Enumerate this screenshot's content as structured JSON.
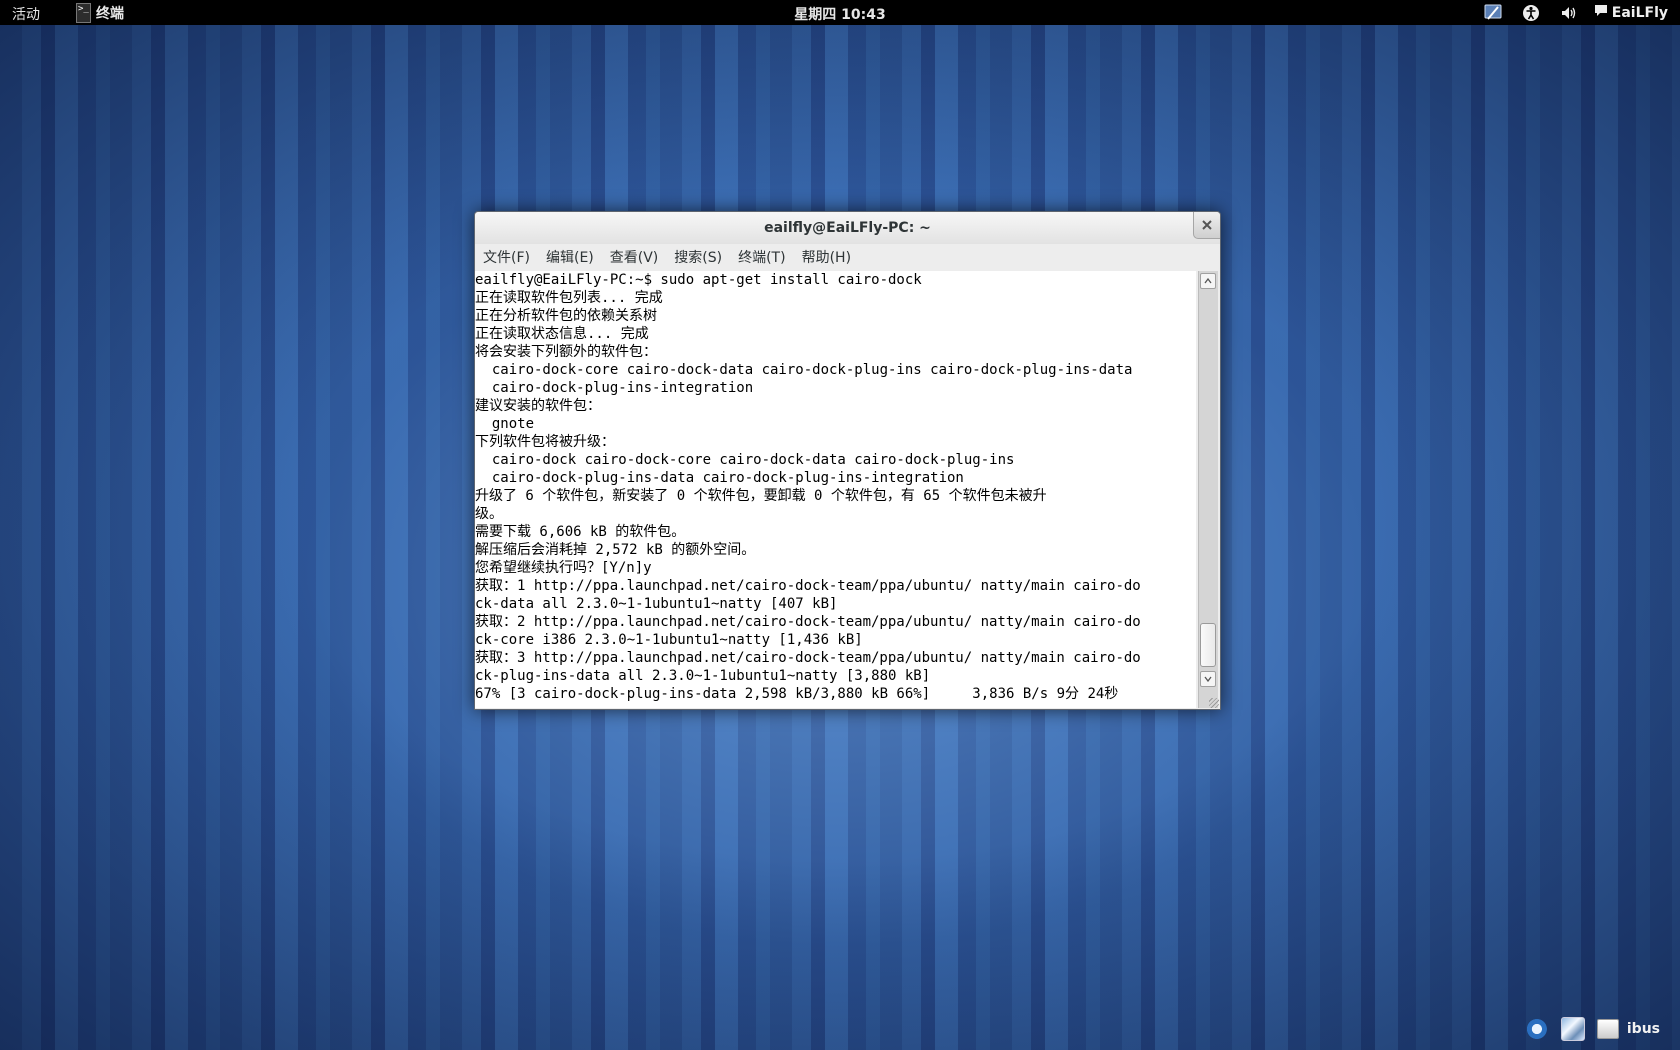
{
  "topbar": {
    "activities": "活动",
    "app_name": "终端",
    "app_icon_glyph": ">_",
    "clock": "星期四 10:43",
    "user_name": "EaiLFly"
  },
  "window": {
    "title": "eailfly@EaiLFly-PC: ~",
    "menu": [
      "文件(F)",
      "编辑(E)",
      "查看(V)",
      "搜索(S)",
      "终端(T)",
      "帮助(H)"
    ],
    "terminal_lines": [
      "eailfly@EaiLFly-PC:~$ sudo apt-get install cairo-dock",
      "正在读取软件包列表... 完成",
      "正在分析软件包的依赖关系树",
      "正在读取状态信息... 完成",
      "将会安装下列额外的软件包：",
      "  cairo-dock-core cairo-dock-data cairo-dock-plug-ins cairo-dock-plug-ins-data",
      "  cairo-dock-plug-ins-integration",
      "建议安装的软件包：",
      "  gnote",
      "下列软件包将被升级：",
      "  cairo-dock cairo-dock-core cairo-dock-data cairo-dock-plug-ins",
      "  cairo-dock-plug-ins-data cairo-dock-plug-ins-integration",
      "升级了 6 个软件包，新安装了 0 个软件包，要卸载 0 个软件包，有 65 个软件包未被升",
      "级。",
      "需要下载 6,606 kB 的软件包。",
      "解压缩后会消耗掉 2,572 kB 的额外空间。",
      "您希望继续执行吗？[Y/n]y",
      "获取：1 http://ppa.launchpad.net/cairo-dock-team/ppa/ubuntu/ natty/main cairo-do",
      "ck-data all 2.3.0~1-1ubuntu1~natty [407 kB]",
      "获取：2 http://ppa.launchpad.net/cairo-dock-team/ppa/ubuntu/ natty/main cairo-do",
      "ck-core i386 2.3.0~1-1ubuntu1~natty [1,436 kB]",
      "获取：3 http://ppa.launchpad.net/cairo-dock-team/ppa/ubuntu/ natty/main cairo-do",
      "ck-plug-ins-data all 2.3.0~1-1ubuntu1~natty [3,880 kB]",
      "67% [3 cairo-dock-plug-ins-data 2,598 kB/3,880 kB 66%]     3,836 B/s 9分 24秒"
    ]
  },
  "bottom_tray": {
    "ibus_label": "ibus"
  }
}
